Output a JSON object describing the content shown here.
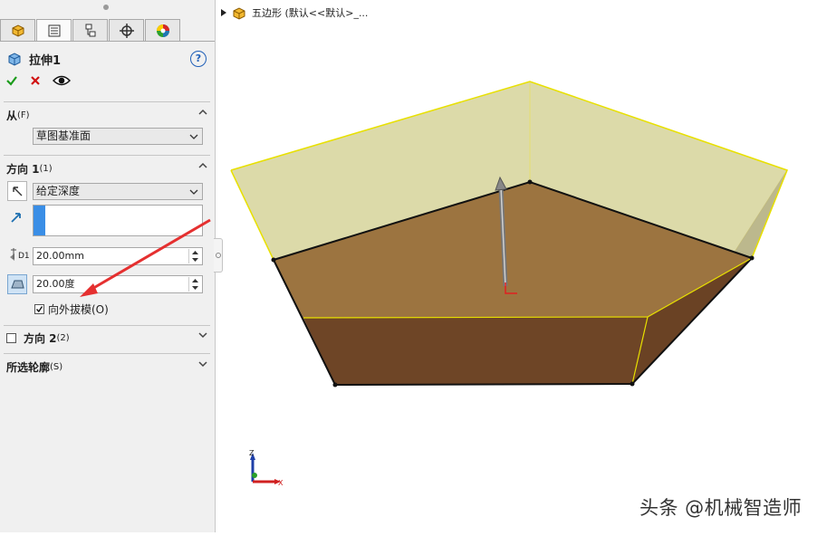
{
  "feature": {
    "title": "拉伸1",
    "help_label": "?"
  },
  "from": {
    "label": "从",
    "hotkey": "(F)",
    "value": "草图基准面"
  },
  "direction1": {
    "label": "方向 1",
    "hotkey": "(1)",
    "end_condition": "给定深度",
    "depth": "20.00mm",
    "draft_angle": "20.00度",
    "draft_outward_label": "向外拔模(O)",
    "draft_outward_checked": true
  },
  "direction2": {
    "label": "方向 2",
    "hotkey": "(2)",
    "checked": false
  },
  "contours": {
    "label": "所选轮廓",
    "hotkey": "(S)"
  },
  "depth_icon_label": "D1",
  "breadcrumb": {
    "text": "五边形 (默认<<默认>_..."
  },
  "triad": {
    "x": "X",
    "z": "Z"
  },
  "watermark": "头条 @机械智造师",
  "colors": {
    "top_face": "#9c7440",
    "side_face": "#6e4526",
    "preview": "#d6d49a",
    "edge_yellow": "#e8e000",
    "accent_blue": "#3a8ee6"
  },
  "icons": [
    "feature-manager-icon",
    "property-manager-icon",
    "configuration-manager-icon",
    "dimxpert-icon",
    "display-manager-icon",
    "extrude-icon",
    "help-icon",
    "ok-check-icon",
    "cancel-x-icon",
    "preview-eye-icon",
    "chevron-up-icon",
    "chevron-down-icon",
    "reverse-direction-icon",
    "direction-vector-icon",
    "depth-icon",
    "draft-icon"
  ]
}
